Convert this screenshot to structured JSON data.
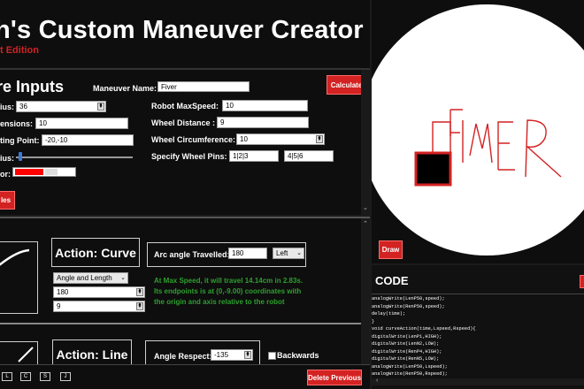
{
  "app": {
    "title": "h's Custom Maneuver Creator",
    "edition": "t Edition"
  },
  "inputs": {
    "section_title": "re Inputs",
    "maneuver_name_label": "Maneuver Name:",
    "maneuver_name_value": "Fiver",
    "calculate_label": "Calculate",
    "radius_label": "ius:",
    "radius_value": "36",
    "dimensions_label": "ensions:",
    "dimensions_value": "10",
    "starting_point_label": "ting Point:",
    "starting_point_value": "-20,-10",
    "slider_label": "ius:",
    "slider_level": 0.05,
    "color_label": "or:",
    "color_value": "#ff0000",
    "robot_maxspeed_label": "Robot MaxSpeed:",
    "robot_maxspeed_value": "10",
    "wheel_distance_label": "Wheel Distance :",
    "wheel_distance_value": "9",
    "wheel_circumference_label": "Wheel Circumference:",
    "wheel_circumference_value": "10",
    "wheel_pins_label": "Specify Wheel Pins:",
    "wheel_pins_left": "1|2|3",
    "wheel_pins_right": "4|5|6",
    "red_button_partial": "les"
  },
  "actions": {
    "curve": {
      "title": "Action: Curve",
      "arc_label": "Arc angle Travelled:",
      "arc_value": "180",
      "direction_value": "Left",
      "mode_value": "Angle and Length",
      "field1": "180",
      "field2": "9",
      "info_line1": "At Max Speed, it will travel 14.14cm in 2.83s.",
      "info_line2": "Its endpoints is at (0,-9.00) coordinates with",
      "info_line3": "the origin and axis relative to the robot"
    },
    "line": {
      "title": "Action: Line",
      "angle_label": "Angle Respect:",
      "angle_value": "-135",
      "backwards_label": "Backwards"
    }
  },
  "bottom_bar": {
    "buttons": [
      "L",
      "C",
      "S",
      "J"
    ],
    "delete_label": "Delete Previous"
  },
  "canvas": {
    "draw_label": "Draw",
    "drawing_text": "FIVER"
  },
  "code": {
    "title": "CODE",
    "lines": [
      "analogWrite(LenP50,speed);",
      "analogWrite(RenP50,speed);",
      "delay(time);",
      "}",
      "void curveAction(time,Lspeed,Rspeed){",
      "digitalWrite(LenP1,HIGH);",
      "digitalWrite(LenN2,LOW);",
      "digitalWrite(RenP4,HIGH);",
      "digitalWrite(RenN5,LOW);",
      "analogWrite(LenP50,Lspeed);",
      "analogWrite(RenP50,Rspeed);"
    ]
  },
  "colors": {
    "accent_red": "#d32222",
    "info_green": "#2e9f2e",
    "panel_bg": "#0e0e0e"
  }
}
